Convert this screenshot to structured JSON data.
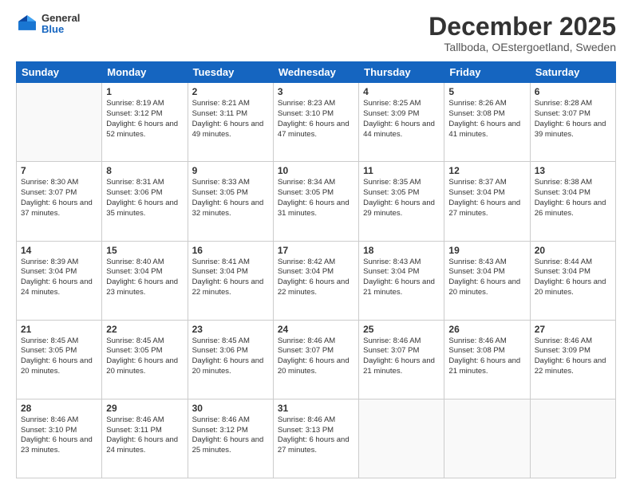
{
  "header": {
    "logo": {
      "general": "General",
      "blue": "Blue"
    },
    "title": "December 2025",
    "subtitle": "Tallboda, OEstergoetland, Sweden"
  },
  "weekdays": [
    "Sunday",
    "Monday",
    "Tuesday",
    "Wednesday",
    "Thursday",
    "Friday",
    "Saturday"
  ],
  "weeks": [
    [
      {
        "day": "",
        "sunrise": "",
        "sunset": "",
        "daylight": ""
      },
      {
        "day": "1",
        "sunrise": "Sunrise: 8:19 AM",
        "sunset": "Sunset: 3:12 PM",
        "daylight": "Daylight: 6 hours and 52 minutes."
      },
      {
        "day": "2",
        "sunrise": "Sunrise: 8:21 AM",
        "sunset": "Sunset: 3:11 PM",
        "daylight": "Daylight: 6 hours and 49 minutes."
      },
      {
        "day": "3",
        "sunrise": "Sunrise: 8:23 AM",
        "sunset": "Sunset: 3:10 PM",
        "daylight": "Daylight: 6 hours and 47 minutes."
      },
      {
        "day": "4",
        "sunrise": "Sunrise: 8:25 AM",
        "sunset": "Sunset: 3:09 PM",
        "daylight": "Daylight: 6 hours and 44 minutes."
      },
      {
        "day": "5",
        "sunrise": "Sunrise: 8:26 AM",
        "sunset": "Sunset: 3:08 PM",
        "daylight": "Daylight: 6 hours and 41 minutes."
      },
      {
        "day": "6",
        "sunrise": "Sunrise: 8:28 AM",
        "sunset": "Sunset: 3:07 PM",
        "daylight": "Daylight: 6 hours and 39 minutes."
      }
    ],
    [
      {
        "day": "7",
        "sunrise": "Sunrise: 8:30 AM",
        "sunset": "Sunset: 3:07 PM",
        "daylight": "Daylight: 6 hours and 37 minutes."
      },
      {
        "day": "8",
        "sunrise": "Sunrise: 8:31 AM",
        "sunset": "Sunset: 3:06 PM",
        "daylight": "Daylight: 6 hours and 35 minutes."
      },
      {
        "day": "9",
        "sunrise": "Sunrise: 8:33 AM",
        "sunset": "Sunset: 3:05 PM",
        "daylight": "Daylight: 6 hours and 32 minutes."
      },
      {
        "day": "10",
        "sunrise": "Sunrise: 8:34 AM",
        "sunset": "Sunset: 3:05 PM",
        "daylight": "Daylight: 6 hours and 31 minutes."
      },
      {
        "day": "11",
        "sunrise": "Sunrise: 8:35 AM",
        "sunset": "Sunset: 3:05 PM",
        "daylight": "Daylight: 6 hours and 29 minutes."
      },
      {
        "day": "12",
        "sunrise": "Sunrise: 8:37 AM",
        "sunset": "Sunset: 3:04 PM",
        "daylight": "Daylight: 6 hours and 27 minutes."
      },
      {
        "day": "13",
        "sunrise": "Sunrise: 8:38 AM",
        "sunset": "Sunset: 3:04 PM",
        "daylight": "Daylight: 6 hours and 26 minutes."
      }
    ],
    [
      {
        "day": "14",
        "sunrise": "Sunrise: 8:39 AM",
        "sunset": "Sunset: 3:04 PM",
        "daylight": "Daylight: 6 hours and 24 minutes."
      },
      {
        "day": "15",
        "sunrise": "Sunrise: 8:40 AM",
        "sunset": "Sunset: 3:04 PM",
        "daylight": "Daylight: 6 hours and 23 minutes."
      },
      {
        "day": "16",
        "sunrise": "Sunrise: 8:41 AM",
        "sunset": "Sunset: 3:04 PM",
        "daylight": "Daylight: 6 hours and 22 minutes."
      },
      {
        "day": "17",
        "sunrise": "Sunrise: 8:42 AM",
        "sunset": "Sunset: 3:04 PM",
        "daylight": "Daylight: 6 hours and 22 minutes."
      },
      {
        "day": "18",
        "sunrise": "Sunrise: 8:43 AM",
        "sunset": "Sunset: 3:04 PM",
        "daylight": "Daylight: 6 hours and 21 minutes."
      },
      {
        "day": "19",
        "sunrise": "Sunrise: 8:43 AM",
        "sunset": "Sunset: 3:04 PM",
        "daylight": "Daylight: 6 hours and 20 minutes."
      },
      {
        "day": "20",
        "sunrise": "Sunrise: 8:44 AM",
        "sunset": "Sunset: 3:04 PM",
        "daylight": "Daylight: 6 hours and 20 minutes."
      }
    ],
    [
      {
        "day": "21",
        "sunrise": "Sunrise: 8:45 AM",
        "sunset": "Sunset: 3:05 PM",
        "daylight": "Daylight: 6 hours and 20 minutes."
      },
      {
        "day": "22",
        "sunrise": "Sunrise: 8:45 AM",
        "sunset": "Sunset: 3:05 PM",
        "daylight": "Daylight: 6 hours and 20 minutes."
      },
      {
        "day": "23",
        "sunrise": "Sunrise: 8:45 AM",
        "sunset": "Sunset: 3:06 PM",
        "daylight": "Daylight: 6 hours and 20 minutes."
      },
      {
        "day": "24",
        "sunrise": "Sunrise: 8:46 AM",
        "sunset": "Sunset: 3:07 PM",
        "daylight": "Daylight: 6 hours and 20 minutes."
      },
      {
        "day": "25",
        "sunrise": "Sunrise: 8:46 AM",
        "sunset": "Sunset: 3:07 PM",
        "daylight": "Daylight: 6 hours and 21 minutes."
      },
      {
        "day": "26",
        "sunrise": "Sunrise: 8:46 AM",
        "sunset": "Sunset: 3:08 PM",
        "daylight": "Daylight: 6 hours and 21 minutes."
      },
      {
        "day": "27",
        "sunrise": "Sunrise: 8:46 AM",
        "sunset": "Sunset: 3:09 PM",
        "daylight": "Daylight: 6 hours and 22 minutes."
      }
    ],
    [
      {
        "day": "28",
        "sunrise": "Sunrise: 8:46 AM",
        "sunset": "Sunset: 3:10 PM",
        "daylight": "Daylight: 6 hours and 23 minutes."
      },
      {
        "day": "29",
        "sunrise": "Sunrise: 8:46 AM",
        "sunset": "Sunset: 3:11 PM",
        "daylight": "Daylight: 6 hours and 24 minutes."
      },
      {
        "day": "30",
        "sunrise": "Sunrise: 8:46 AM",
        "sunset": "Sunset: 3:12 PM",
        "daylight": "Daylight: 6 hours and 25 minutes."
      },
      {
        "day": "31",
        "sunrise": "Sunrise: 8:46 AM",
        "sunset": "Sunset: 3:13 PM",
        "daylight": "Daylight: 6 hours and 27 minutes."
      },
      {
        "day": "",
        "sunrise": "",
        "sunset": "",
        "daylight": ""
      },
      {
        "day": "",
        "sunrise": "",
        "sunset": "",
        "daylight": ""
      },
      {
        "day": "",
        "sunrise": "",
        "sunset": "",
        "daylight": ""
      }
    ]
  ]
}
